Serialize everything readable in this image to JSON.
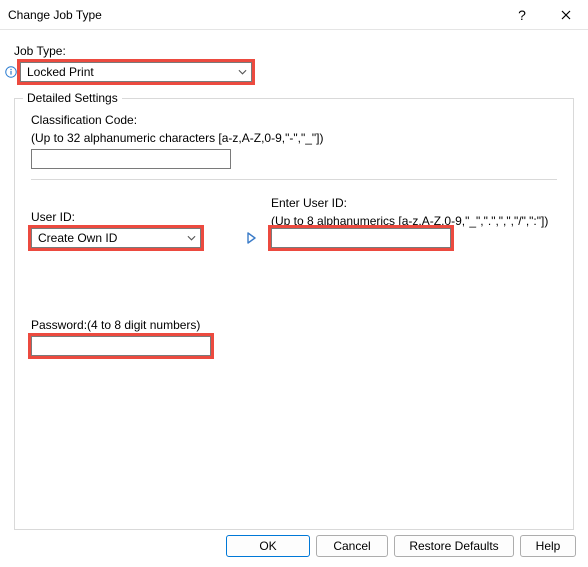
{
  "window": {
    "title": "Change Job Type"
  },
  "jobtype": {
    "label": "Job Type:",
    "selected": "Locked Print"
  },
  "detailed": {
    "legend": "Detailed Settings",
    "classification": {
      "label": "Classification Code:",
      "hint": "(Up to 32 alphanumeric characters [a-z,A-Z,0-9,\"-\",\"_\"])",
      "value": ""
    },
    "userid": {
      "label": "User ID:",
      "selected": "Create Own ID"
    },
    "enter_userid": {
      "label": "Enter User ID:",
      "hint": "(Up to 8 alphanumerics [a-z,A-Z,0-9,\"_\",\".\",\",\",\"/\",\":\"])",
      "value": ""
    },
    "password": {
      "label": "Password:(4 to 8 digit numbers)",
      "value": ""
    }
  },
  "buttons": {
    "ok": "OK",
    "cancel": "Cancel",
    "restore": "Restore Defaults",
    "help": "Help"
  }
}
